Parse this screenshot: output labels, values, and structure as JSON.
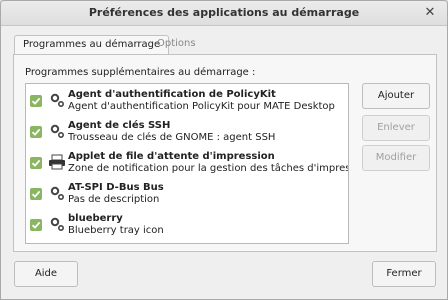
{
  "window": {
    "title": "Préférences des applications au démarrage"
  },
  "tabs": [
    {
      "label": "Programmes au démarrage",
      "active": true
    },
    {
      "label": "Options",
      "active": false
    }
  ],
  "section_label": "Programmes supplémentaires au démarrage :",
  "programs": [
    {
      "name": "Agent d'authentification de PolicyKit",
      "description": "Agent d'authentification PolicyKit pour MATE Desktop",
      "enabled": true,
      "icon": "gear-icon"
    },
    {
      "name": "Agent de clés SSH",
      "description": "Trousseau de clés de GNOME : agent SSH",
      "enabled": true,
      "icon": "gear-icon"
    },
    {
      "name": "Applet de file d'attente d'impression",
      "description": "Zone de notification pour la gestion des tâches d'impression",
      "enabled": true,
      "icon": "printer-icon"
    },
    {
      "name": "AT-SPI D-Bus Bus",
      "description": "Pas de description",
      "enabled": true,
      "icon": "gear-icon"
    },
    {
      "name": "blueberry",
      "description": "Blueberry tray icon",
      "enabled": true,
      "icon": "gear-icon"
    }
  ],
  "side_buttons": {
    "add": "Ajouter",
    "remove": "Enlever",
    "edit": "Modifier"
  },
  "footer": {
    "help": "Aide",
    "close": "Fermer"
  },
  "colors": {
    "check": "#8ab561",
    "window_bg": "#efefef"
  }
}
